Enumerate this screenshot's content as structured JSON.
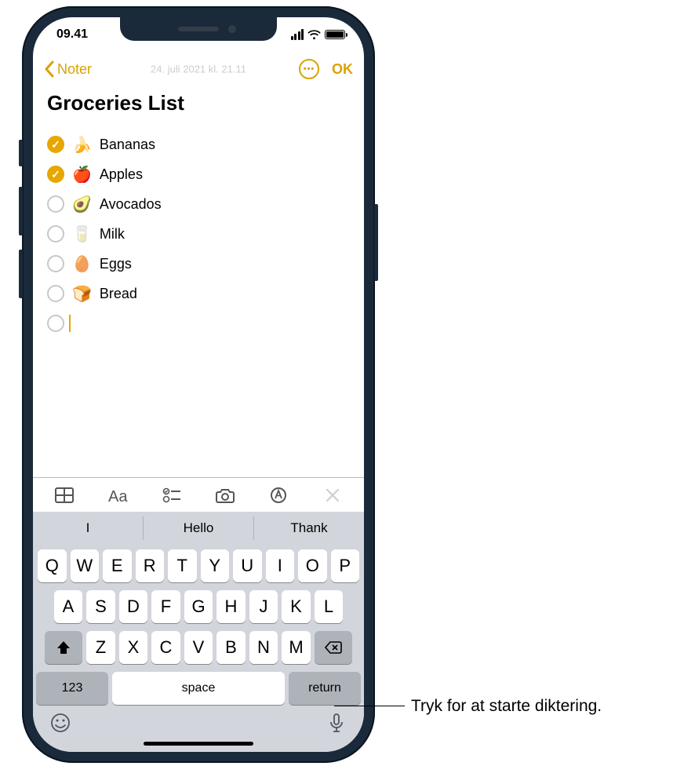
{
  "status": {
    "time": "09.41"
  },
  "nav": {
    "back_label": "Noter",
    "date_text": "24. juli 2021 kl. 21.11",
    "ok_label": "OK"
  },
  "note": {
    "title": "Groceries List",
    "items": [
      {
        "checked": true,
        "emoji": "🍌",
        "label": "Bananas"
      },
      {
        "checked": true,
        "emoji": "🍎",
        "label": "Apples"
      },
      {
        "checked": false,
        "emoji": "🥑",
        "label": "Avocados"
      },
      {
        "checked": false,
        "emoji": "🥛",
        "label": "Milk"
      },
      {
        "checked": false,
        "emoji": "🥚",
        "label": "Eggs"
      },
      {
        "checked": false,
        "emoji": "🍞",
        "label": "Bread"
      }
    ]
  },
  "suggestions": [
    "I",
    "Hello",
    "Thank"
  ],
  "keyboard": {
    "row1": [
      "Q",
      "W",
      "E",
      "R",
      "T",
      "Y",
      "U",
      "I",
      "O",
      "P"
    ],
    "row2": [
      "A",
      "S",
      "D",
      "F",
      "G",
      "H",
      "J",
      "K",
      "L"
    ],
    "row3": [
      "Z",
      "X",
      "C",
      "V",
      "B",
      "N",
      "M"
    ],
    "num_label": "123",
    "space_label": "space",
    "return_label": "return"
  },
  "callout": "Tryk for at starte diktering."
}
